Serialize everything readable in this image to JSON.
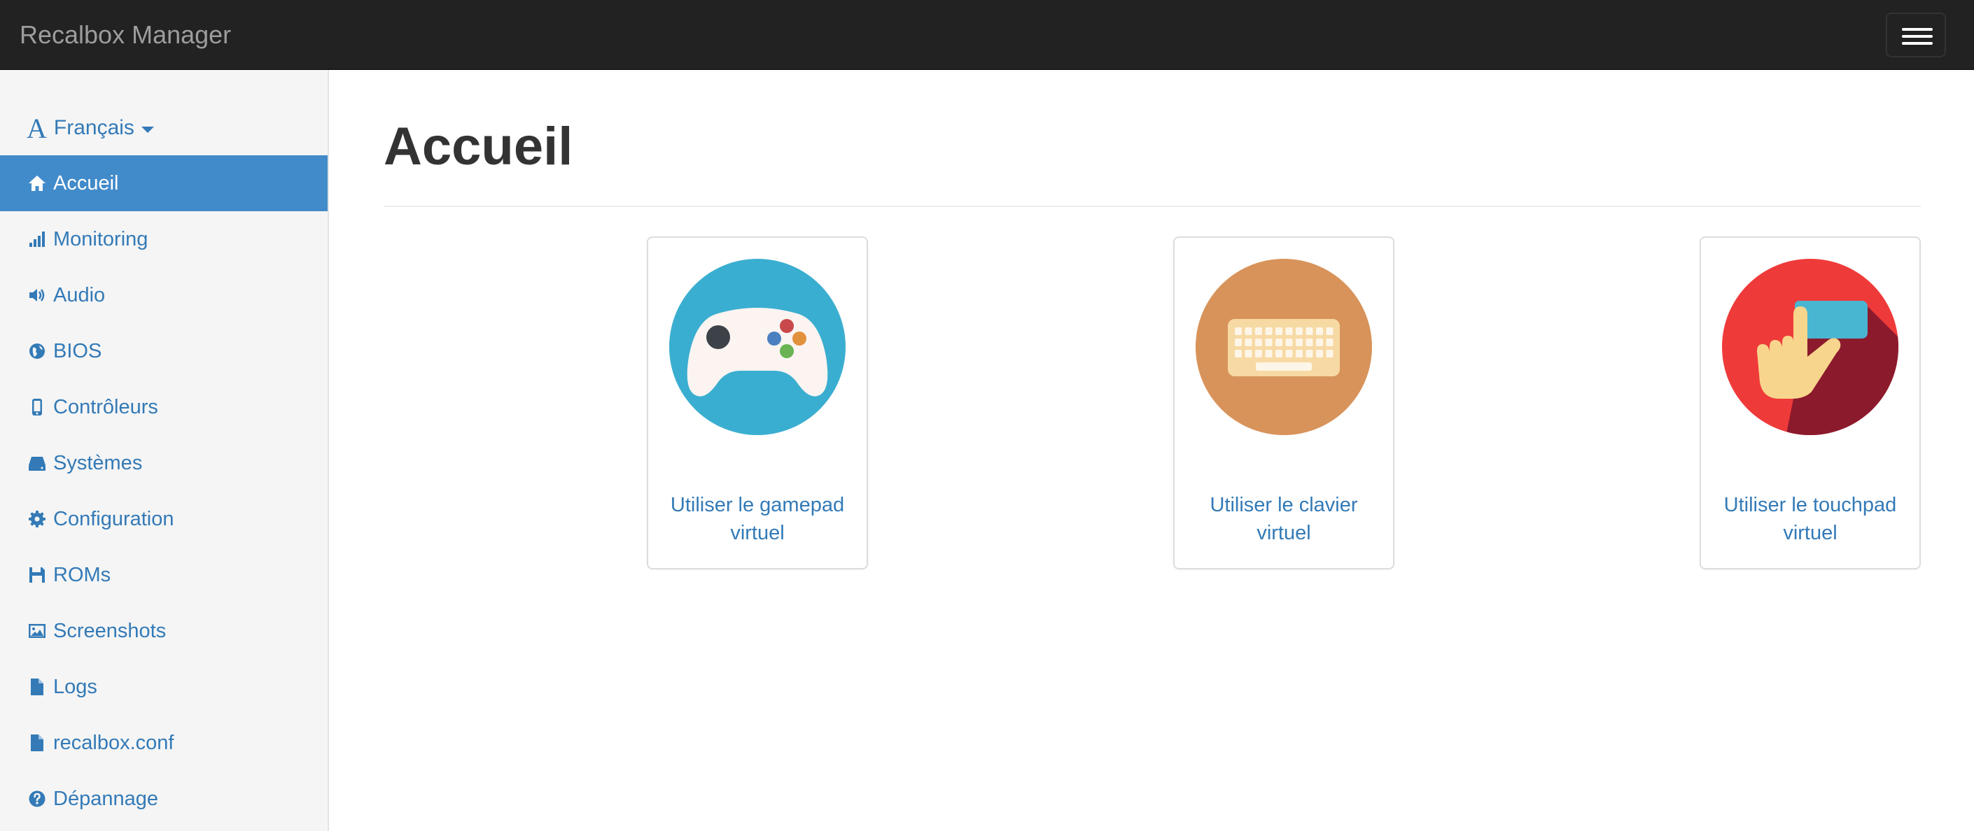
{
  "app": {
    "brand": "Recalbox Manager"
  },
  "sidebar": {
    "language": {
      "label": "Français",
      "icon": "font-letter-icon"
    },
    "items": [
      {
        "label": "Accueil",
        "icon": "home-icon",
        "active": true
      },
      {
        "label": "Monitoring",
        "icon": "signal-bars-icon",
        "active": false
      },
      {
        "label": "Audio",
        "icon": "volume-icon",
        "active": false
      },
      {
        "label": "BIOS",
        "icon": "globe-icon",
        "active": false
      },
      {
        "label": "Contrôleurs",
        "icon": "phone-icon",
        "active": false
      },
      {
        "label": "Systèmes",
        "icon": "hard-drive-icon",
        "active": false
      },
      {
        "label": "Configuration",
        "icon": "gear-icon",
        "active": false
      },
      {
        "label": "ROMs",
        "icon": "floppy-disk-icon",
        "active": false
      },
      {
        "label": "Screenshots",
        "icon": "picture-icon",
        "active": false
      },
      {
        "label": "Logs",
        "icon": "file-icon",
        "active": false
      },
      {
        "label": "recalbox.conf",
        "icon": "file-icon",
        "active": false
      },
      {
        "label": "Dépannage",
        "icon": "question-circle-icon",
        "active": false
      }
    ]
  },
  "main": {
    "title": "Accueil",
    "cards": [
      {
        "label": "Utiliser le gamepad virtuel",
        "icon": "gamepad-icon",
        "color": "#3aaed0"
      },
      {
        "label": "Utiliser le clavier virtuel",
        "icon": "keyboard-icon",
        "color": "#d8935a"
      },
      {
        "label": "Utiliser le touchpad virtuel",
        "icon": "touchpad-hand-icon",
        "color": "#ef3a3a"
      }
    ]
  },
  "colors": {
    "navbar": "#222222",
    "accent": "#428bca",
    "link": "#337ab7"
  }
}
